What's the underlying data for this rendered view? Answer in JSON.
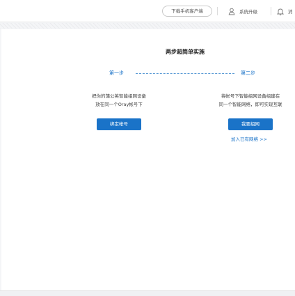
{
  "header": {
    "download_label": "下载手机客户端",
    "upgrade_label": "系统升级",
    "notifications_label": "消"
  },
  "main": {
    "title": "两步超简单实施",
    "step1": {
      "label": "第一步",
      "description_line1": "把你的蒲公英智能组网设备",
      "description_line2": "放在同一个Oray帐号下",
      "button_label": "绑定帐号"
    },
    "step2": {
      "label": "第二步",
      "description_line1": "将帐号下智能组网设备组建在",
      "description_line2": "同一个智能网络，即可实现互联",
      "button_label": "我要组网",
      "link_label": "加入已有网络 >>"
    }
  },
  "colors": {
    "accent": "#1a73c8",
    "background": "#f4f5f7",
    "panel": "#ffffff"
  },
  "icons": [
    "user-shield-icon",
    "bell-icon"
  ]
}
